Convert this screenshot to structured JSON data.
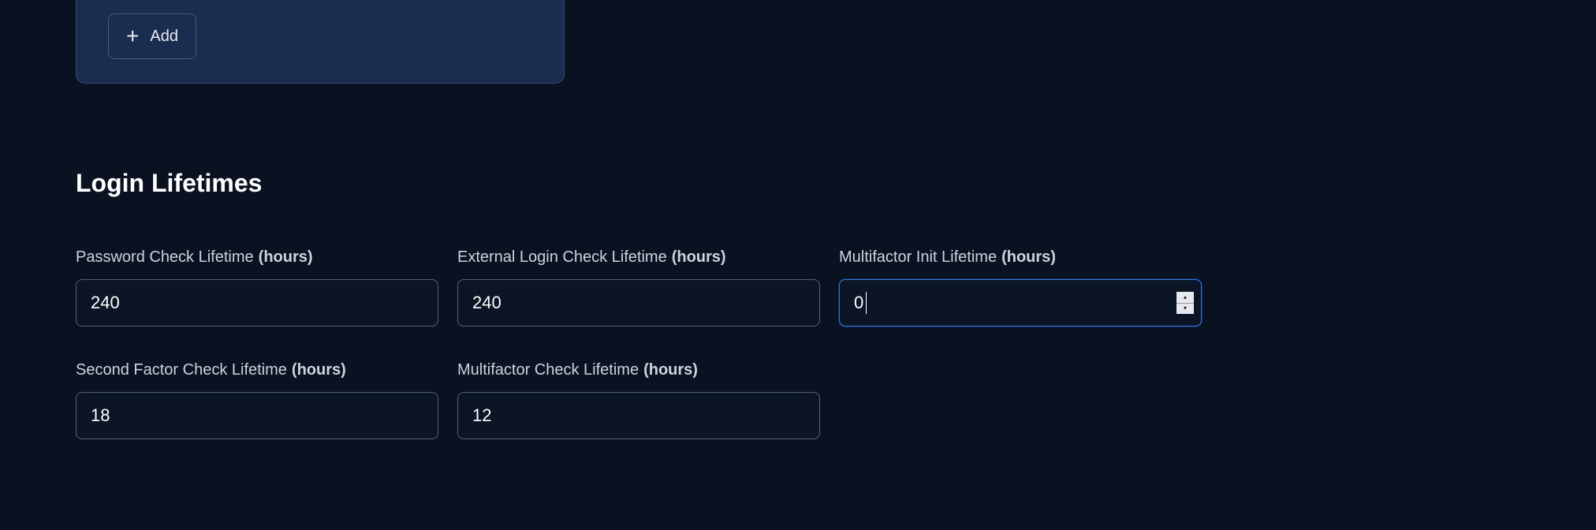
{
  "card": {
    "add_button_label": "Add"
  },
  "section": {
    "heading": "Login Lifetimes"
  },
  "fields": {
    "password_check": {
      "label": "Password Check Lifetime",
      "unit": "(hours)",
      "value": "240"
    },
    "external_login_check": {
      "label": "External Login Check Lifetime",
      "unit": "(hours)",
      "value": "240"
    },
    "multifactor_init": {
      "label": "Multifactor Init Lifetime",
      "unit": "(hours)",
      "value": "0"
    },
    "second_factor_check": {
      "label": "Second Factor Check Lifetime ",
      "unit": "(hours)",
      "value": "18"
    },
    "multifactor_check": {
      "label": "Multifactor Check Lifetime ",
      "unit": "(hours)",
      "value": "12"
    }
  }
}
